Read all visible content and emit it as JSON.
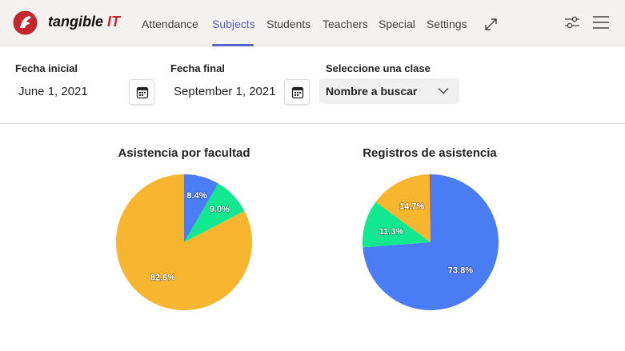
{
  "header": {
    "brand_part1": "tangible",
    "brand_part2": "IT",
    "nav": [
      {
        "label": "Attendance",
        "active": false
      },
      {
        "label": "Subjects",
        "active": true
      },
      {
        "label": "Students",
        "active": false
      },
      {
        "label": "Teachers",
        "active": false
      },
      {
        "label": "Special",
        "active": false
      },
      {
        "label": "Settings",
        "active": false
      }
    ],
    "icons": [
      "expand-icon",
      "filter-sliders-icon",
      "menu-icon"
    ]
  },
  "filters": {
    "start_date_label": "Fecha inicial",
    "start_date_value": "June 1, 2021",
    "end_date_label": "Fecha final",
    "end_date_value": "September 1, 2021",
    "class_label": "Seleccione una clase",
    "class_value": "Nombre a buscar"
  },
  "chart_data": [
    {
      "type": "pie",
      "title": "Asistencia por facultad",
      "slices": [
        {
          "label": "8.4%",
          "value": 8.4,
          "color": "#4a7cf6"
        },
        {
          "label": "9.0%",
          "value": 9.0,
          "color": "#11e88f"
        },
        {
          "label": "82.6%",
          "value": 82.6,
          "color": "#f8b52f"
        }
      ]
    },
    {
      "type": "pie",
      "title": "Registros de asistencia",
      "slices": [
        {
          "label": "73.8%",
          "value": 73.8,
          "color": "#4a7cf6"
        },
        {
          "label": "11.3%",
          "value": 11.3,
          "color": "#11e88f"
        },
        {
          "label": "14.7%",
          "value": 14.7,
          "color": "#f8b52f"
        },
        {
          "label": "",
          "value": 0.2,
          "color": "#e5322d"
        }
      ]
    }
  ],
  "colors": {
    "accent": "#5b5fc7",
    "brand_red": "#c4262e"
  }
}
